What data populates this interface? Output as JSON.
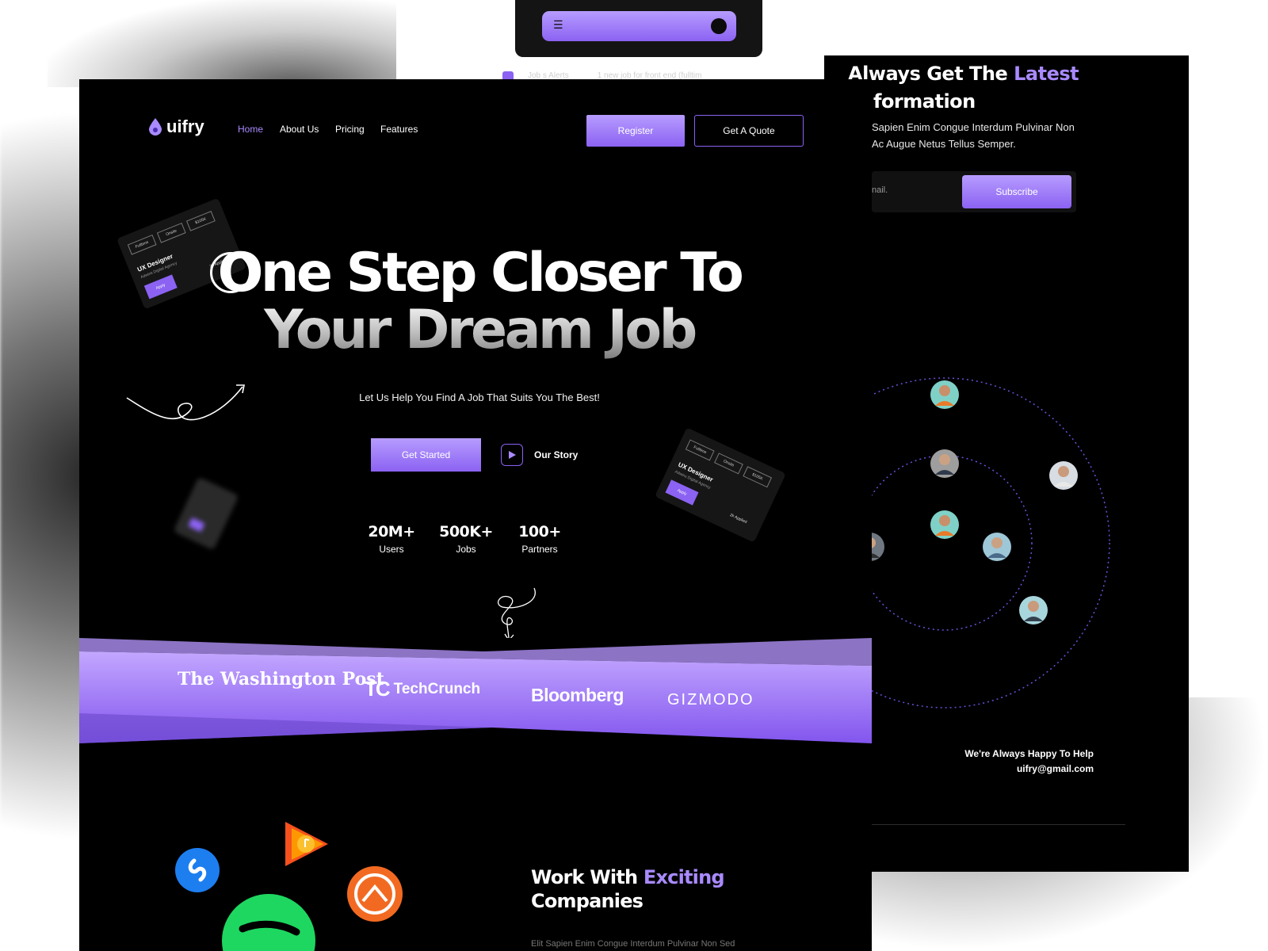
{
  "phone": {
    "menu_icon": "☰",
    "row_label": "Job s Alerts",
    "row_text": "1 new job for front end (fulltim"
  },
  "right_panel": {
    "title_prefix": "Always Get The ",
    "title_accent": "Latest",
    "title_line2": "formation",
    "text_line1": "Sapien Enim Congue Interdum Pulvinar Non",
    "text_line2": "Ac Augue Netus Tellus Semper.",
    "email_placeholder": "nail.",
    "subscribe_label": "Subscribe",
    "help_text": "We're Always Happy To Help",
    "help_email": "uifry@gmail.com"
  },
  "nav": {
    "logo": "uifry",
    "links": [
      "Home",
      "About Us",
      "Pricing",
      "Features"
    ],
    "active": "Home",
    "register_label": "Register",
    "quote_label": "Get A Quote"
  },
  "hero": {
    "line1": "One Step Closer To",
    "line2": "Your Dream Job",
    "subtitle": "Let Us Help You Find A Job That Suits You The Best!",
    "started_label": "Get Started",
    "story_label": "Our Story"
  },
  "stats": [
    {
      "value": "20M+",
      "label": "Users"
    },
    {
      "value": "500K+",
      "label": "Jobs"
    },
    {
      "value": "100+",
      "label": "Partners"
    }
  ],
  "job_card": {
    "tags": [
      "Fulltime",
      "Onsite",
      "$105K"
    ],
    "title": "UX Designer",
    "company": "Adwins Digital Agency",
    "apply": "Apply",
    "applied": "2k Applied"
  },
  "brands": [
    "The Washington Post",
    "TechCrunch",
    "Bloomberg",
    "GIZMODO"
  ],
  "companies": {
    "title_prefix": "Work With ",
    "title_accent": "Exciting",
    "title_line2": "Companies",
    "text": "Elit Sapien Enim Congue Interdum Pulvinar Non Sed"
  },
  "colors": {
    "accent": "#a98aff",
    "button": "#8b62f2",
    "background": "#000000"
  },
  "icons": [
    "shazam-icon",
    "google-play-music-icon",
    "grooveshark-icon",
    "spotify-icon",
    "play-icon",
    "drop-logo-icon"
  ]
}
